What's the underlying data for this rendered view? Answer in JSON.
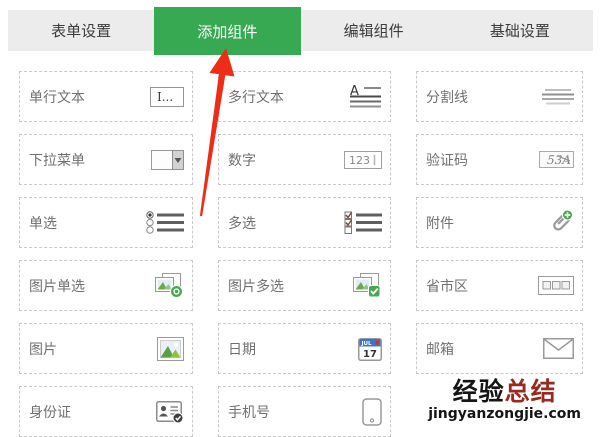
{
  "tabs": [
    {
      "label": "表单设置",
      "active": false
    },
    {
      "label": "添加组件",
      "active": true
    },
    {
      "label": "编辑组件",
      "active": false
    },
    {
      "label": "基础设置",
      "active": false
    }
  ],
  "colors": {
    "active_tab_green": "#38a953",
    "tabbar_gray": "#ececec",
    "arrow_red": "#ed2d16",
    "badge_green": "#4ba654",
    "watermark_black": "#151515",
    "watermark_red": "#992a20"
  },
  "grid": {
    "items": [
      {
        "label": "单行文本",
        "icon": "text-input-icon"
      },
      {
        "label": "多行文本",
        "icon": "textarea-icon"
      },
      {
        "label": "分割线",
        "icon": "divider-icon"
      },
      {
        "label": "下拉菜单",
        "icon": "dropdown-icon"
      },
      {
        "label": "数字",
        "icon": "number-input-icon"
      },
      {
        "label": "验证码",
        "icon": "captcha-icon"
      },
      {
        "label": "单选",
        "icon": "radio-group-icon"
      },
      {
        "label": "多选",
        "icon": "checkbox-group-icon"
      },
      {
        "label": "附件",
        "icon": "attachment-icon"
      },
      {
        "label": "图片单选",
        "icon": "image-radio-icon"
      },
      {
        "label": "图片多选",
        "icon": "image-checkbox-icon"
      },
      {
        "label": "省市区",
        "icon": "region-icon"
      },
      {
        "label": "图片",
        "icon": "image-icon"
      },
      {
        "label": "日期",
        "icon": "calendar-icon"
      },
      {
        "label": "邮箱",
        "icon": "email-icon"
      },
      {
        "label": "身份证",
        "icon": "id-card-icon"
      },
      {
        "label": "手机号",
        "icon": "phone-icon"
      }
    ]
  },
  "icon_text": {
    "input": "I...",
    "number": "123",
    "captcha": "53A",
    "calendar_month": "JUL",
    "calendar_day": "17"
  },
  "watermark": {
    "part1": "经验",
    "part2": "总结",
    "url": "jingyanzongjie.com"
  }
}
